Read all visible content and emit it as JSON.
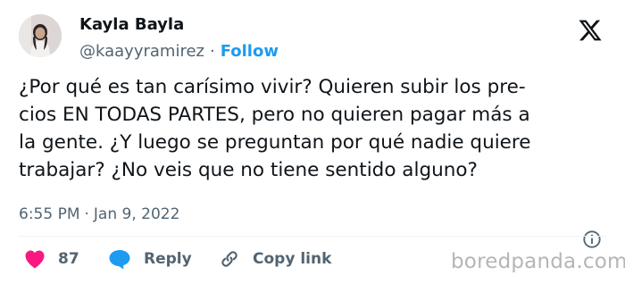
{
  "tweet": {
    "author": {
      "name": "Kayla Bayla",
      "handle": "@kaayyramirez",
      "separator": "·",
      "follow_label": "Follow"
    },
    "platform_icon": "x-logo-icon",
    "body_lines": [
      "¿Por qué es tan carísimo vivir? Quieren subir los pre-",
      "cios EN TODAS PARTES, pero no quieren pagar más a",
      "la gente. ¿Y luego se preguntan por qué nadie quiere",
      "trabajar?  ¿No veis que no tiene sentido alguno?"
    ],
    "meta": {
      "time": "6:55 PM",
      "separator": "·",
      "date": "Jan 9, 2022",
      "info_icon": "info-icon"
    },
    "actions": {
      "like": {
        "icon": "heart-icon",
        "count": "87"
      },
      "reply": {
        "icon": "speech-bubble-icon",
        "label": "Reply"
      },
      "copy_link": {
        "icon": "link-icon",
        "label": "Copy link"
      }
    }
  },
  "watermark": "boredpanda.com",
  "colors": {
    "text_primary": "#0f1419",
    "text_secondary": "#536471",
    "accent_blue": "#1d9bf0",
    "like_red": "#f91880",
    "divider": "#eff3f4",
    "watermark": "#b5b5b5"
  }
}
